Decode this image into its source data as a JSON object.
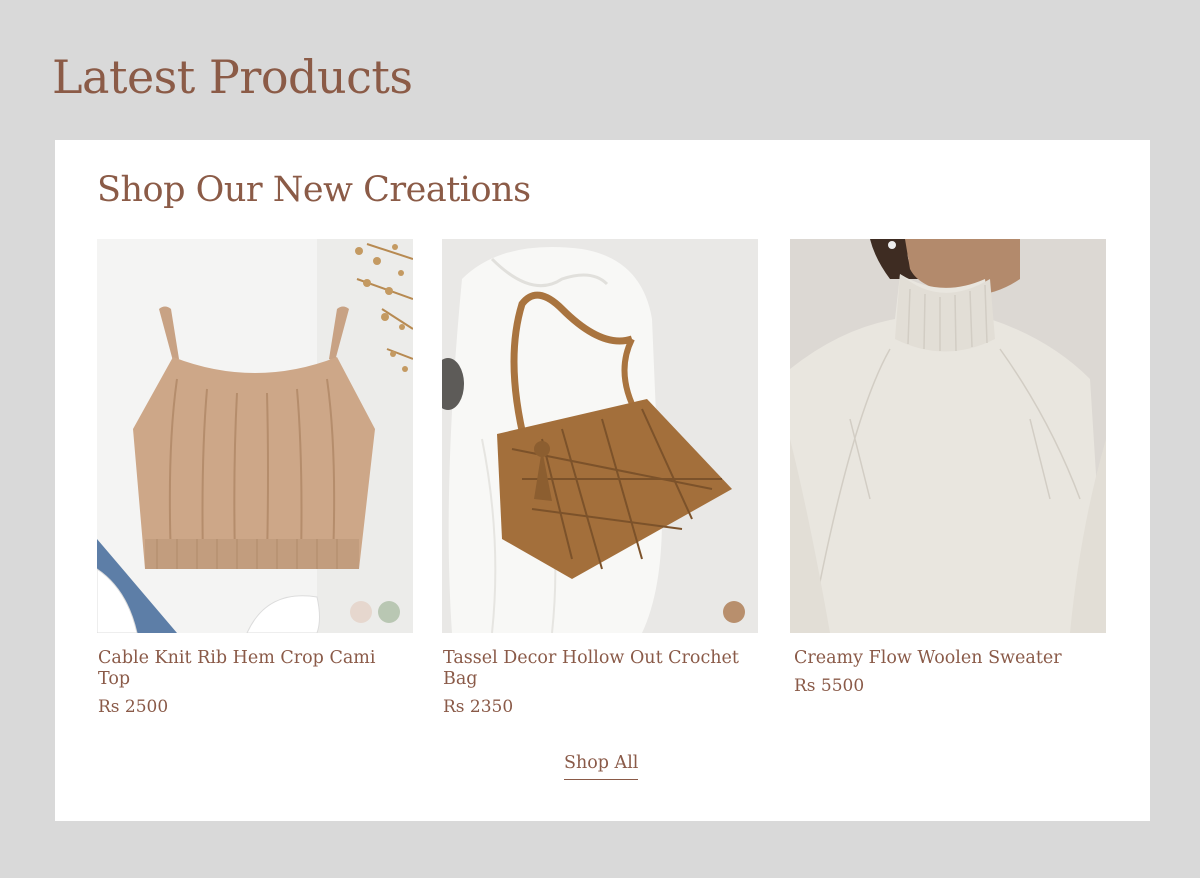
{
  "page": {
    "title": "Latest Products"
  },
  "section": {
    "title": "Shop Our New Creations"
  },
  "products": [
    {
      "name": "Cable Knit Rib Hem Crop Cami Top",
      "price": "Rs 2500",
      "image": "cable-knit-cami-top-photo",
      "swatches": [
        "#e6d7ce",
        "#b9c7b3"
      ]
    },
    {
      "name": "Tassel Decor Hollow Out Crochet Bag",
      "price": "Rs 2350",
      "image": "crochet-tassel-bag-photo",
      "swatches": [
        "#b88f6d"
      ]
    },
    {
      "name": "Creamy Flow Woolen Sweater",
      "price": "Rs 5500",
      "image": "woolen-sweater-photo",
      "swatches": []
    }
  ],
  "cta": {
    "label": "Shop All"
  },
  "colors": {
    "background": "#d9d9d9",
    "panel": "#ffffff",
    "accent_text": "#8b5b47"
  }
}
